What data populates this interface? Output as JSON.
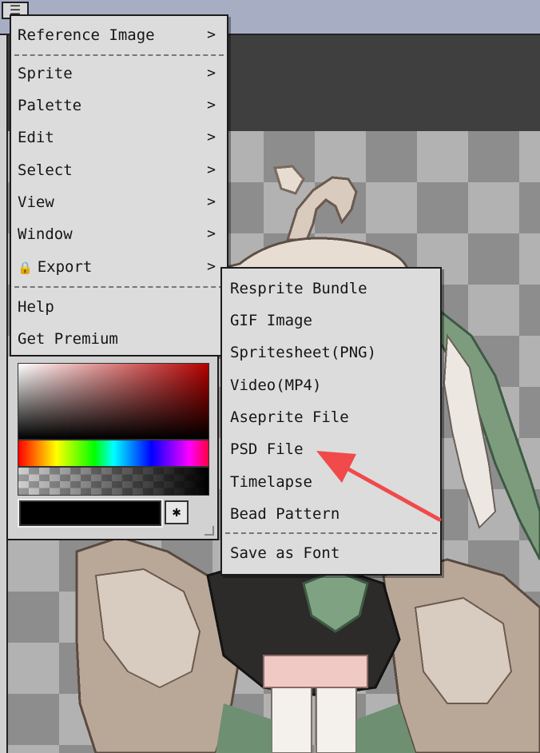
{
  "app": {
    "menu_icon_glyph": "☰",
    "menu_icon_name": "main-menu-icon"
  },
  "main_menu": {
    "items": [
      {
        "label": "Reference Image",
        "chevron": ">"
      },
      {
        "label": "Sprite",
        "chevron": ">"
      },
      {
        "label": "Palette",
        "chevron": ">"
      },
      {
        "label": "Edit",
        "chevron": ">"
      },
      {
        "label": "Select",
        "chevron": ">"
      },
      {
        "label": "View",
        "chevron": ">"
      },
      {
        "label": "Window",
        "chevron": ">"
      },
      {
        "label": "Export",
        "chevron": ">",
        "lock_glyph": "🔒"
      },
      {
        "label": "Help"
      },
      {
        "label": "Get Premium"
      }
    ]
  },
  "export_submenu": {
    "items": [
      {
        "label": "Resprite Bundle"
      },
      {
        "label": "GIF Image"
      },
      {
        "label": "Spritesheet(PNG)"
      },
      {
        "label": "Video(MP4)"
      },
      {
        "label": "Aseprite File"
      },
      {
        "label": "PSD File",
        "highlighted_by_annotation": true
      },
      {
        "label": "Timelapse"
      },
      {
        "label": "Bead Pattern"
      },
      {
        "label": "Save as Font"
      }
    ]
  },
  "color_picker": {
    "current_color": "#000000",
    "base_hue_color": "#b40000",
    "eyedropper_glyph": "✱"
  },
  "annotation": {
    "arrow_color": "#f04a4a",
    "points_to": "PSD File"
  },
  "colors": {
    "menu_bg": "#dcdcdc",
    "menu_border": "#1c1c1c",
    "checker_light": "#b2b2b2",
    "checker_dark": "#8d8d8d",
    "topbar": "#a7aec4"
  }
}
